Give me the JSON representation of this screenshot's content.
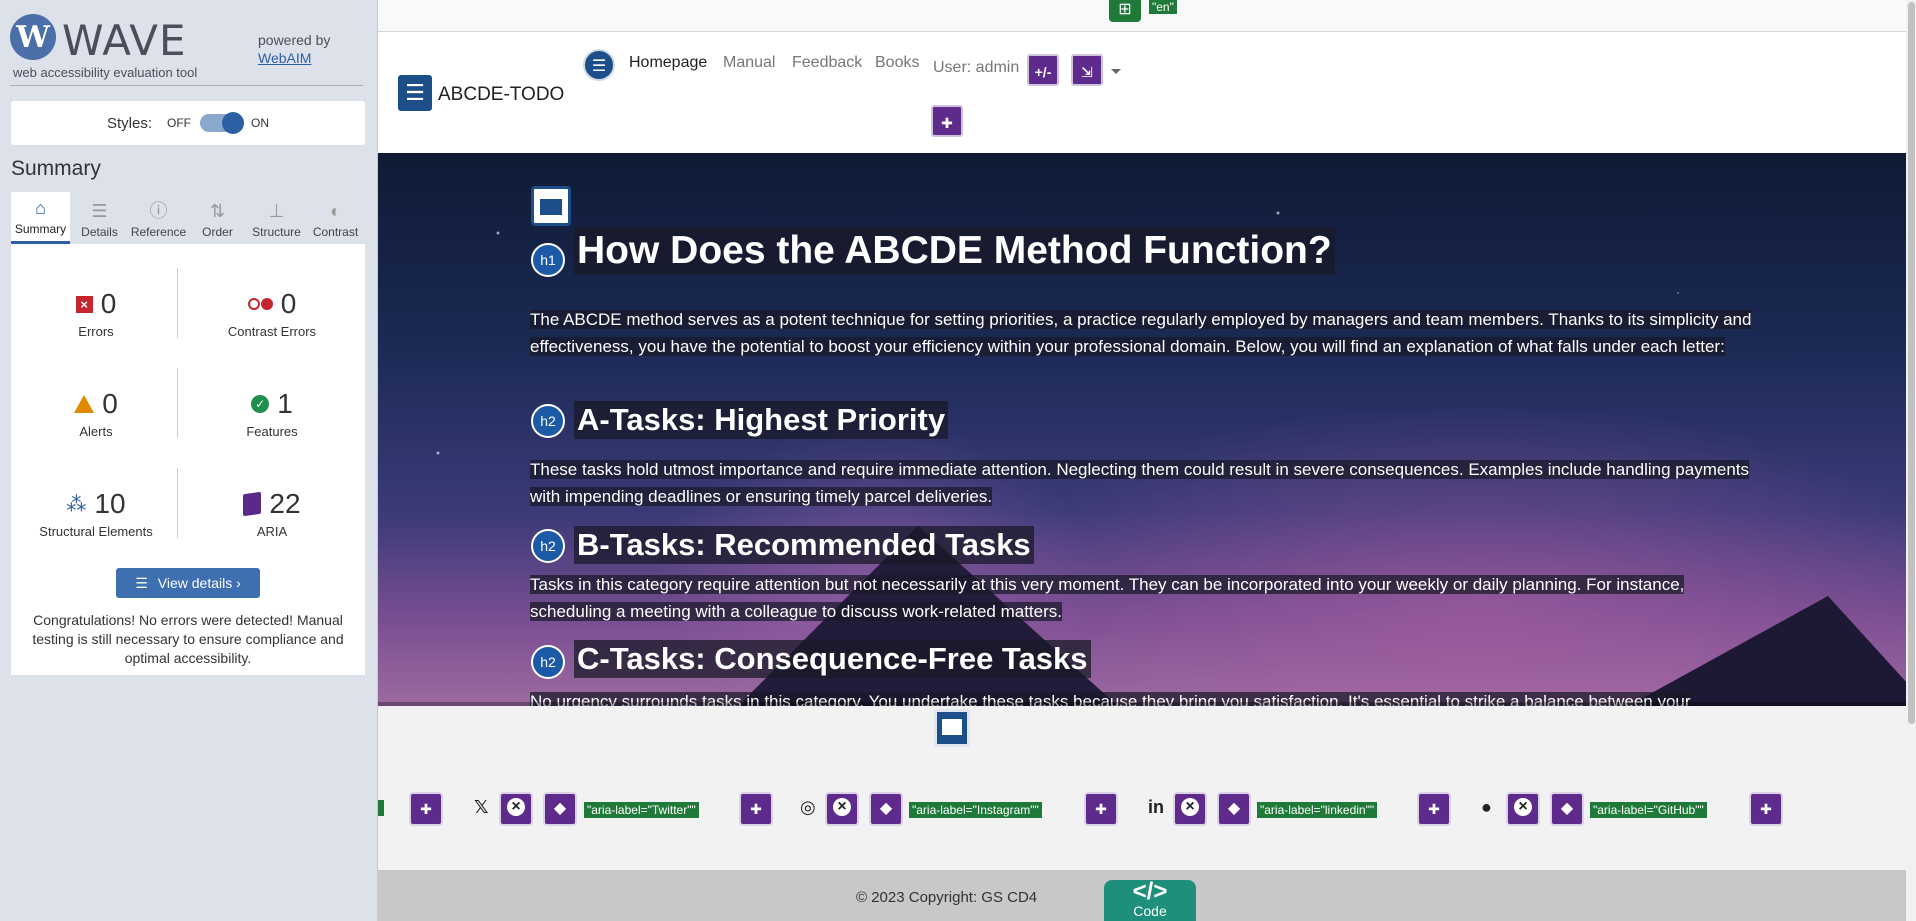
{
  "wave": {
    "logo_letter": "W",
    "name": "WAVE",
    "tagline": "web accessibility evaluation tool",
    "powered_by": "powered by",
    "powered_link": "WebAIM",
    "styles_label": "Styles:",
    "styles_off": "OFF",
    "styles_on": "ON",
    "summary_title": "Summary",
    "tabs": [
      {
        "label": "Summary",
        "icon": "home-icon"
      },
      {
        "label": "Details",
        "icon": "list-icon"
      },
      {
        "label": "Reference",
        "icon": "info-icon"
      },
      {
        "label": "Order",
        "icon": "order-icon"
      },
      {
        "label": "Structure",
        "icon": "structure-icon"
      },
      {
        "label": "Contrast",
        "icon": "contrast-icon"
      }
    ],
    "stats": {
      "errors": {
        "value": "0",
        "label": "Errors"
      },
      "contrast_errors": {
        "value": "0",
        "label": "Contrast Errors"
      },
      "alerts": {
        "value": "0",
        "label": "Alerts"
      },
      "features": {
        "value": "1",
        "label": "Features"
      },
      "structural": {
        "value": "10",
        "label": "Structural Elements"
      },
      "aria": {
        "value": "22",
        "label": "ARIA"
      }
    },
    "view_details": "View details ›",
    "congrats": "Congratulations! No errors were detected! Manual testing is still necessary to ensure compliance and optimal accessibility.",
    "colors": {
      "accent": "#2d5fa4",
      "error": "#c4262e",
      "alert": "#e08a00",
      "feature": "#1f8f4e",
      "aria": "#5e2a8c"
    }
  },
  "page": {
    "lang_tag": "\"en\"",
    "brand": "ABCDE-TODO",
    "nav": {
      "home": "Homepage",
      "manual": "Manual",
      "feedback": "Feedback",
      "books": "Books",
      "user": "User: admin",
      "btn1": "+/-",
      "btn2": "⇲"
    },
    "hero": {
      "h1_badge": "h1",
      "h2_badge": "h2",
      "h1": "How Does the ABCDE Method Function?",
      "intro": "The ABCDE method serves as a potent technique for setting priorities, a practice regularly employed by managers and team members. Thanks to its simplicity and effectiveness, you have the potential to boost your efficiency within your professional domain. Below, you will find an explanation of what falls under each letter:",
      "a_title": "A-Tasks: Highest Priority",
      "a_text": "These tasks hold utmost importance and require immediate attention. Neglecting them could result in severe consequences. Examples include handling payments with impending deadlines or ensuring timely parcel deliveries.",
      "b_title": "B-Tasks: Recommended Tasks",
      "b_text": "Tasks in this category require attention but not necessarily at this very moment. They can be incorporated into your weekly or daily planning. For instance, scheduling a meeting with a colleague to discuss work-related matters.",
      "c_title": "C-Tasks: Consequence-Free Tasks",
      "c_text": "No urgency surrounds tasks in this category. You undertake these tasks because they bring you satisfaction. It's essential to strike a balance between your"
    },
    "social": {
      "twitter": "\"aria-label=\"Twitter\"\"",
      "instagram": "\"aria-label=\"Instagram\"\"",
      "linkedin": "\"aria-label=\"linkedin\"\"",
      "github": "\"aria-label=\"GitHub\"\""
    },
    "footer": {
      "copyright": "© 2023 Copyright: GS CD4",
      "code_symbol": "</>",
      "code_label": "Code"
    }
  }
}
